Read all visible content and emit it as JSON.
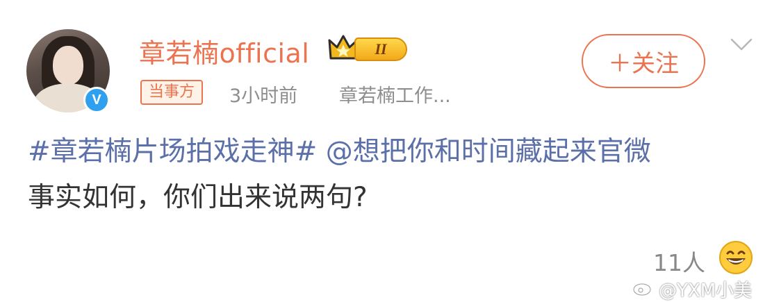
{
  "author": {
    "name": "章若楠official",
    "level_badge": "II",
    "verified_mark": "V",
    "tag": "当事方",
    "time": "3小时前",
    "source": "章若楠工作..."
  },
  "follow_button": {
    "label": "＋关注"
  },
  "post": {
    "topic": "#章若楠片场拍戏走神#",
    "mention": "@想把你和时间藏起来官微",
    "line2": "事实如何，你们出来说两句?"
  },
  "footer": {
    "count": "11人",
    "reaction_icon": "grinning-face-icon"
  },
  "watermark": {
    "text": "@YXM小美",
    "icon": "weibo-logo-icon"
  },
  "colors": {
    "accent": "#eb7350",
    "link": "#5b6fa8",
    "verified": "#2fa0f0",
    "meta": "#8e8e8e"
  }
}
